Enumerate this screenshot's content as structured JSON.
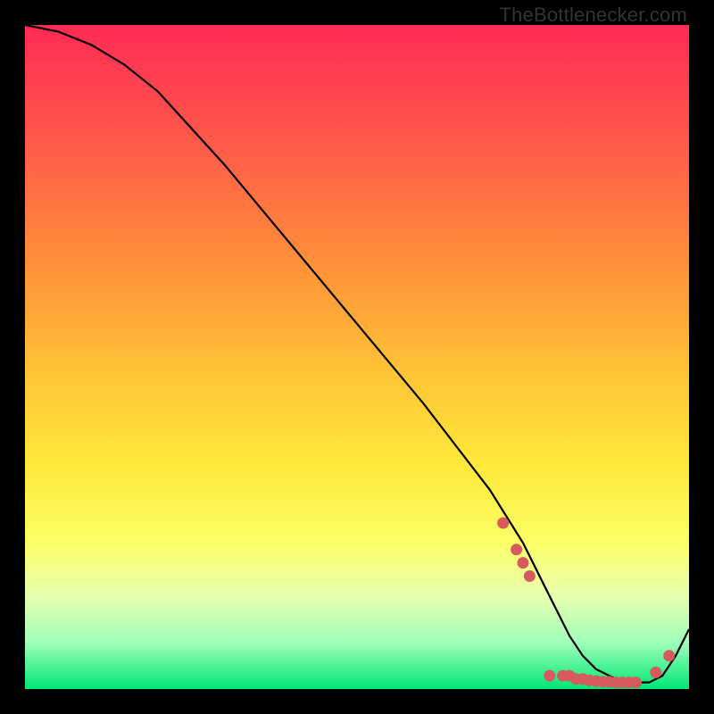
{
  "watermark": "TheBottlenecker.com",
  "chart_data": {
    "type": "line",
    "title": "",
    "xlabel": "",
    "ylabel": "",
    "xlim": [
      0,
      100
    ],
    "ylim": [
      0,
      100
    ],
    "series": [
      {
        "name": "curve",
        "x": [
          0,
          5,
          10,
          15,
          20,
          30,
          40,
          50,
          60,
          70,
          75,
          78,
          80,
          82,
          84,
          86,
          88,
          90,
          92,
          94,
          96,
          98,
          100
        ],
        "y": [
          100,
          99,
          97,
          94,
          90,
          79,
          67,
          55,
          43,
          30,
          22,
          16,
          12,
          8,
          5,
          3,
          2,
          1,
          1,
          1,
          2,
          5,
          9
        ]
      }
    ],
    "markers": {
      "name": "highlight-dots",
      "color": "#d65a5e",
      "points_x": [
        72,
        74,
        75,
        76,
        79,
        81,
        82,
        83,
        84,
        85,
        86,
        87,
        88,
        89,
        90,
        91,
        92,
        95,
        97
      ],
      "points_y": [
        25,
        21,
        19,
        17,
        2,
        2,
        2,
        1.5,
        1.5,
        1.3,
        1.2,
        1.1,
        1.1,
        1,
        1,
        1,
        1,
        2.5,
        5
      ]
    },
    "gradient_stops": [
      {
        "pos": 0.0,
        "color": "#ff2a55"
      },
      {
        "pos": 0.18,
        "color": "#ff5a4a"
      },
      {
        "pos": 0.34,
        "color": "#ff8a3a"
      },
      {
        "pos": 0.52,
        "color": "#ffc236"
      },
      {
        "pos": 0.66,
        "color": "#ffe83a"
      },
      {
        "pos": 0.78,
        "color": "#fbff66"
      },
      {
        "pos": 0.86,
        "color": "#e8ffb0"
      },
      {
        "pos": 0.93,
        "color": "#9fffb9"
      },
      {
        "pos": 1.0,
        "color": "#00e676"
      }
    ]
  }
}
